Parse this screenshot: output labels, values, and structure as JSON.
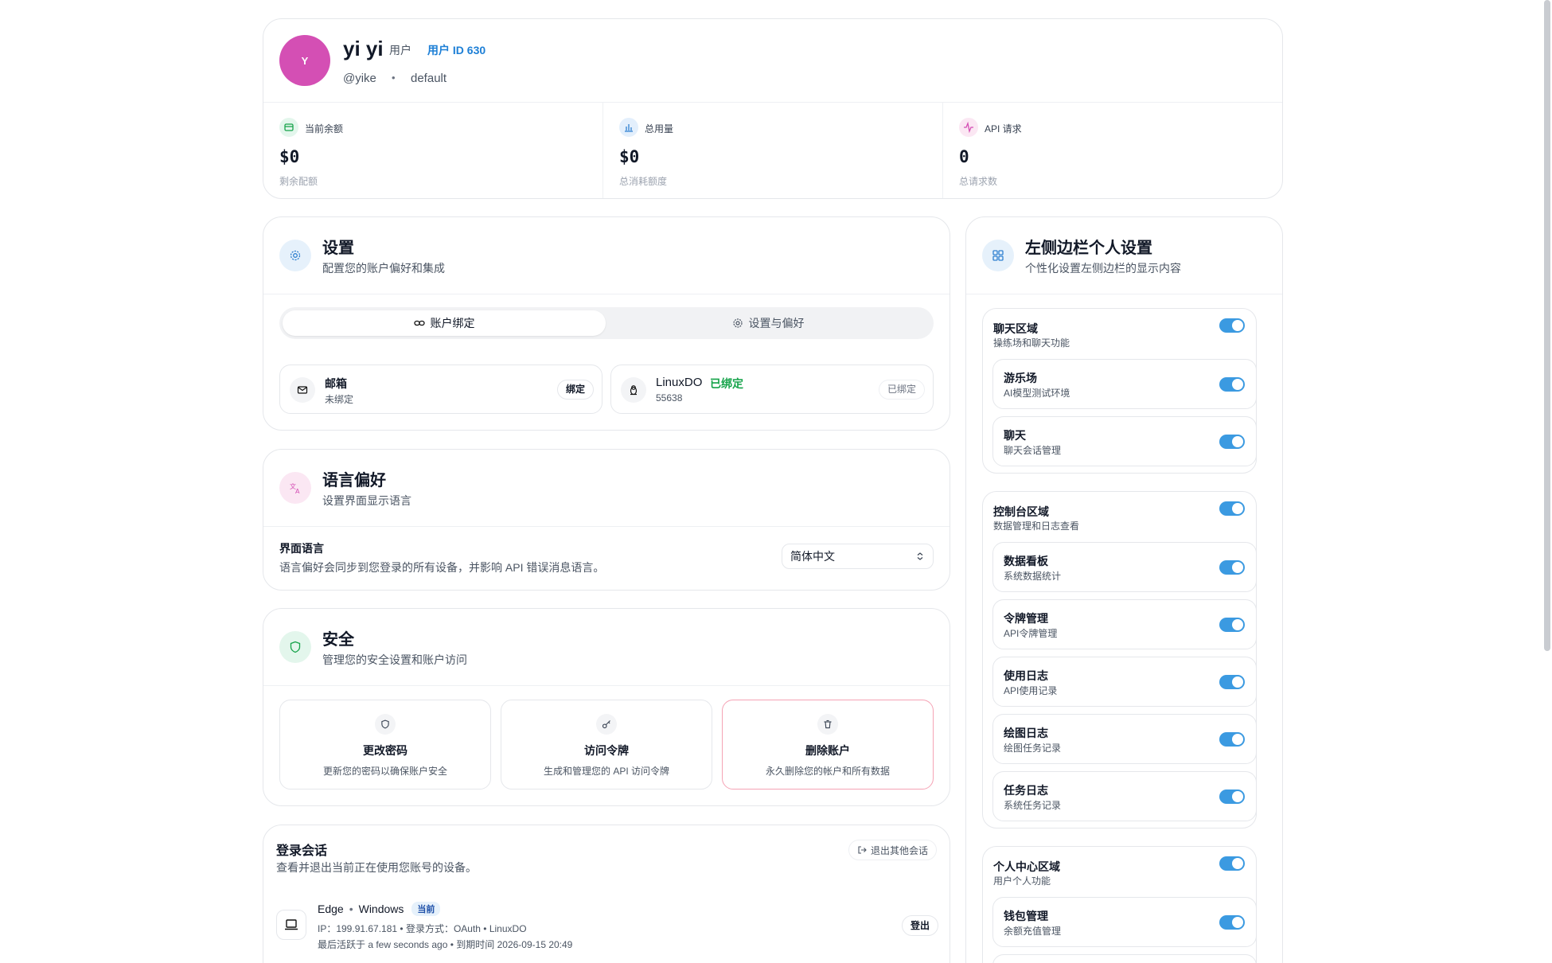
{
  "profile": {
    "avatar_letter": "Y",
    "display_name": "yi yi",
    "role": "用户",
    "user_id": "用户 ID 630",
    "username": "@yike",
    "separator": "•",
    "group": "default"
  },
  "stats": [
    {
      "label": "当前余额",
      "value": "$0",
      "sub": "剩余配额",
      "icon": "wallet-icon"
    },
    {
      "label": "总用量",
      "value": "$0",
      "sub": "总消耗额度",
      "icon": "bar-chart-icon"
    },
    {
      "label": "API 请求",
      "value": "0",
      "sub": "总请求数",
      "icon": "activity-icon"
    }
  ],
  "settings": {
    "title": "设置",
    "subtitle": "配置您的账户偏好和集成",
    "tabs": [
      {
        "label": "账户绑定",
        "icon": "link-icon",
        "active": true
      },
      {
        "label": "设置与偏好",
        "icon": "gear-icon",
        "active": false
      }
    ],
    "bindings": [
      {
        "name": "邮箱",
        "status": "未绑定",
        "badge": "",
        "action": "绑定",
        "icon": "mail-icon"
      },
      {
        "name": "LinuxDO",
        "status": "55638",
        "badge": "已绑定",
        "action": "已绑定",
        "icon": "penguin-icon"
      }
    ]
  },
  "language": {
    "title": "语言偏好",
    "subtitle": "设置界面显示语言",
    "field_label": "界面语言",
    "field_desc": "语言偏好会同步到您登录的所有设备，并影响 API 错误消息语言。",
    "selected": "简体中文"
  },
  "security": {
    "title": "安全",
    "subtitle": "管理您的安全设置和账户访问",
    "cards": [
      {
        "title": "更改密码",
        "desc": "更新您的密码以确保账户安全",
        "icon": "shield-icon"
      },
      {
        "title": "访问令牌",
        "desc": "生成和管理您的 API 访问令牌",
        "icon": "key-icon"
      },
      {
        "title": "删除账户",
        "desc": "永久删除您的帐户和所有数据",
        "icon": "trash-icon"
      }
    ]
  },
  "sessions": {
    "title": "登录会话",
    "subtitle": "查看并退出当前正在使用您账号的设备。",
    "logout_others": "退出其他会话",
    "items": [
      {
        "browser": "Edge",
        "sep": "•",
        "os": "Windows",
        "badge": "当前",
        "detail": "IP：199.91.67.181 • 登录方式：OAuth • LinuxDO",
        "activity": "最后活跃于 a few seconds ago • 到期时间 2026-09-15 20:49",
        "action": "登出"
      }
    ]
  },
  "sidebar_settings": {
    "title": "左侧边栏个人设置",
    "subtitle": "个性化设置左侧边栏的显示内容",
    "groups": [
      {
        "title": "聊天区域",
        "sub": "操练场和聊天功能",
        "enabled": true,
        "items": [
          {
            "title": "游乐场",
            "sub": "AI模型测试环境",
            "enabled": true
          },
          {
            "title": "聊天",
            "sub": "聊天会话管理",
            "enabled": true
          }
        ]
      },
      {
        "title": "控制台区域",
        "sub": "数据管理和日志查看",
        "enabled": true,
        "items": [
          {
            "title": "数据看板",
            "sub": "系统数据统计",
            "enabled": true
          },
          {
            "title": "令牌管理",
            "sub": "API令牌管理",
            "enabled": true
          },
          {
            "title": "使用日志",
            "sub": "API使用记录",
            "enabled": true
          },
          {
            "title": "绘图日志",
            "sub": "绘图任务记录",
            "enabled": true
          },
          {
            "title": "任务日志",
            "sub": "系统任务记录",
            "enabled": true
          }
        ]
      },
      {
        "title": "个人中心区域",
        "sub": "用户个人功能",
        "enabled": true,
        "items": [
          {
            "title": "钱包管理",
            "sub": "余额充值管理",
            "enabled": true
          }
        ]
      }
    ]
  },
  "colors": {
    "accent": "#3b9ae1",
    "avatar": "#d44fb4",
    "success": "#16a34a",
    "danger_border": "#f5a3b5",
    "link": "#1d7fd6"
  }
}
